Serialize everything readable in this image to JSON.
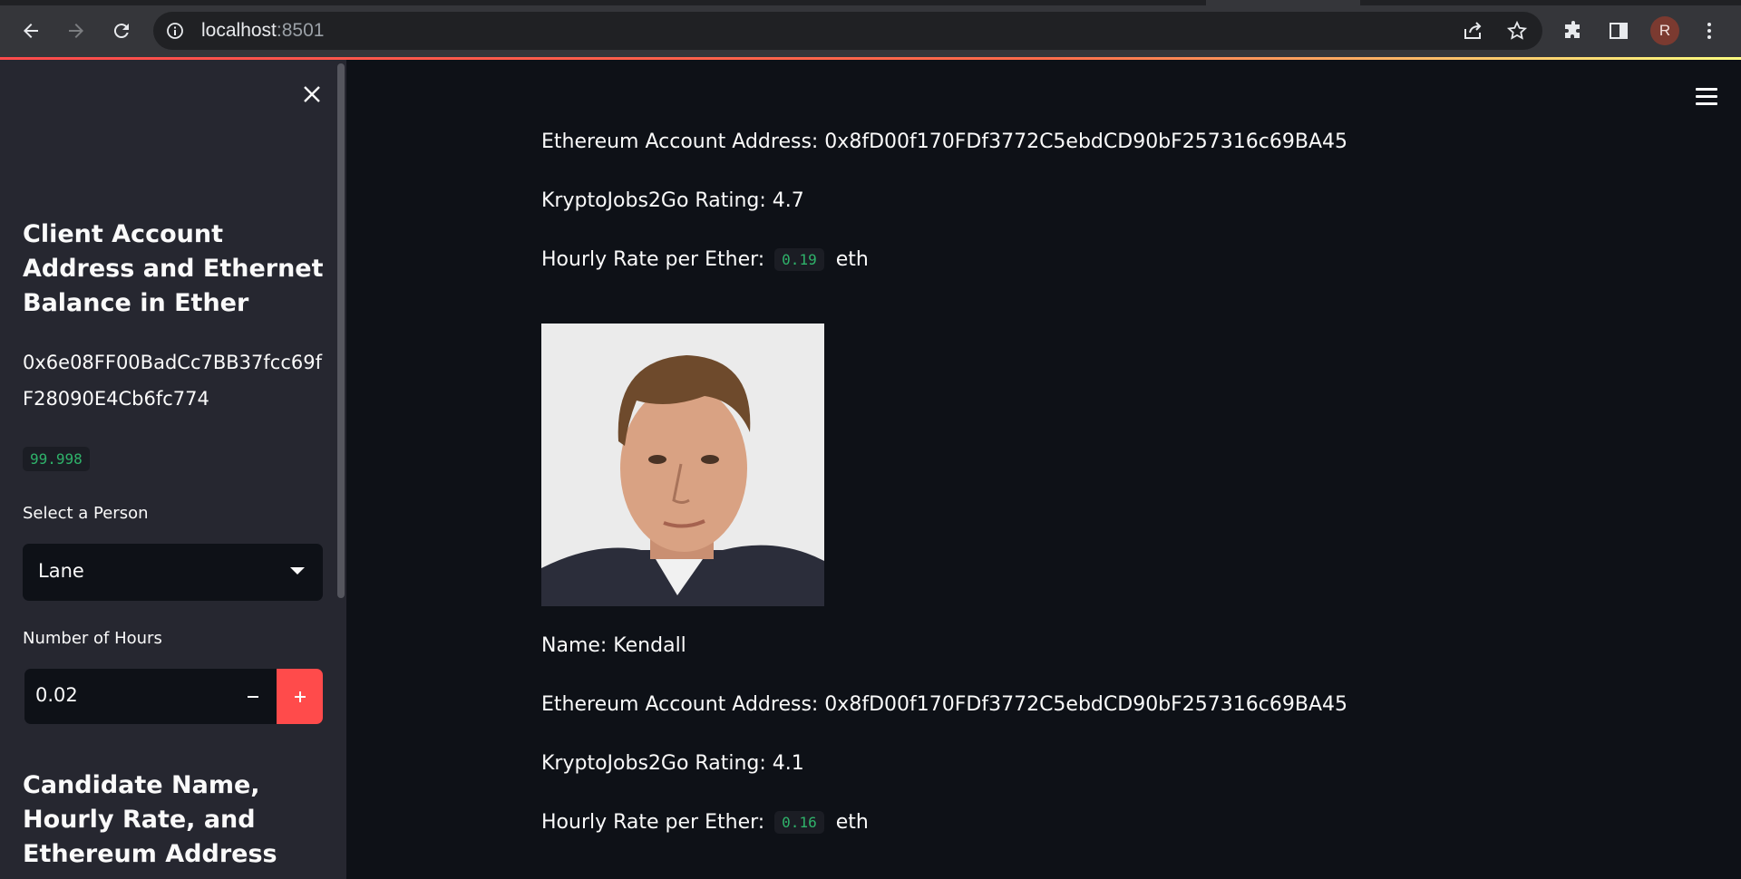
{
  "browser": {
    "url_host": "localhost",
    "url_port": ":8501",
    "profile_initial": "R"
  },
  "sidebar": {
    "heading_balance": "Client Account Address and Ethernet Balance in Ether",
    "client_address": "0x6e08FF00BadCc7BB37fcc69fF28090E4Cb6fc774",
    "balance": "99.998",
    "select_label": "Select a Person",
    "selected_person": "Lane",
    "hours_label": "Number of Hours",
    "hours_value": "0.02",
    "heading_candidate": "Candidate Name, Hourly Rate, and Ethereum Address"
  },
  "main": {
    "candidate_1": {
      "address_line": "Ethereum Account Address: 0x8fD00f170FDf3772C5ebdCD90bF257316c69BA45",
      "rating_line": "KryptoJobs2Go Rating: 4.7",
      "rate_label": "Hourly Rate per Ether:",
      "rate_value": "0.19",
      "rate_unit": "eth"
    },
    "candidate_2": {
      "name_line": "Name: Kendall",
      "address_line": "Ethereum Account Address: 0x8fD00f170FDf3772C5ebdCD90bF257316c69BA45",
      "rating_line": "KryptoJobs2Go Rating: 4.1",
      "rate_label": "Hourly Rate per Ether:",
      "rate_value": "0.16",
      "rate_unit": "eth"
    }
  },
  "colors": {
    "background": "#0e1117",
    "sidebar": "#262730",
    "accent": "#ff4b4b",
    "code_text": "#2fb26a"
  }
}
